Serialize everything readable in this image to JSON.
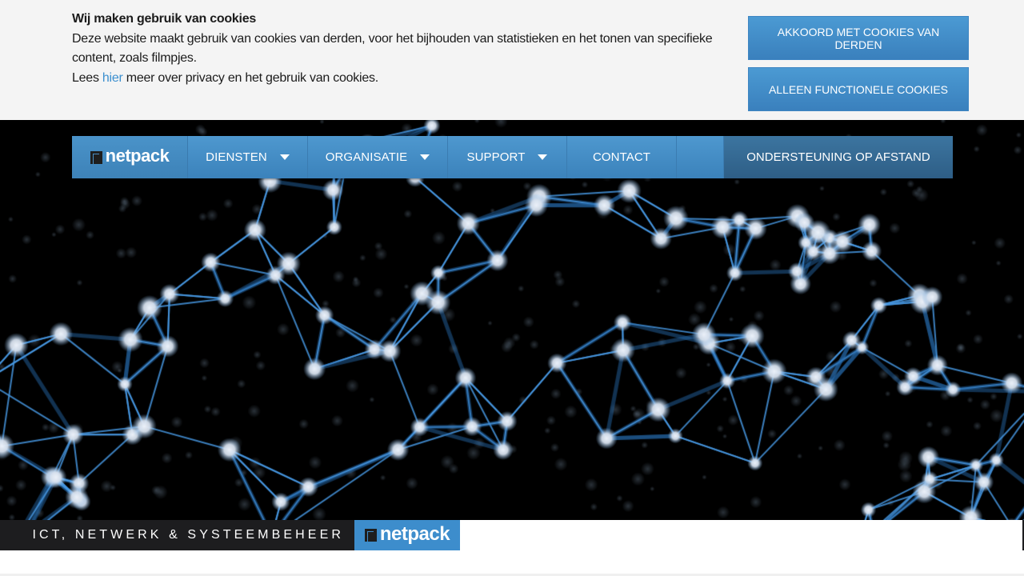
{
  "cookie_banner": {
    "title": "Wij maken gebruik van cookies",
    "body": "Deze website maakt gebruik van cookies van derden, voor het bijhouden van statistieken en het tonen van specifieke content, zoals filmpjes.",
    "read_prefix": "Lees ",
    "read_link": "hier",
    "read_suffix": " meer over privacy en het gebruik van cookies.",
    "accept_all_button": "AKKOORD MET COOKIES VAN DERDEN",
    "functional_only_button": "ALLEEN FUNCTIONELE COOKIES"
  },
  "nav": {
    "logo_text": "netpack",
    "items": [
      {
        "label": "DIENSTEN",
        "has_dropdown": true
      },
      {
        "label": "ORGANISATIE",
        "has_dropdown": true
      },
      {
        "label": "SUPPORT",
        "has_dropdown": true
      },
      {
        "label": "CONTACT",
        "has_dropdown": false
      }
    ],
    "remote_support": "ONDERSTEUNING OP AFSTAND"
  },
  "hero": {
    "image_subject": "network-globe",
    "tagline": "ICT, NETWERK & SYSTEEMBEHEER",
    "tagline_logo": "netpack"
  },
  "colors": {
    "brand_blue": "#3d8dcc",
    "nav_dark": "#2e5e86",
    "link": "#3b8fcf",
    "cookie_bg": "#f4f4f4"
  }
}
